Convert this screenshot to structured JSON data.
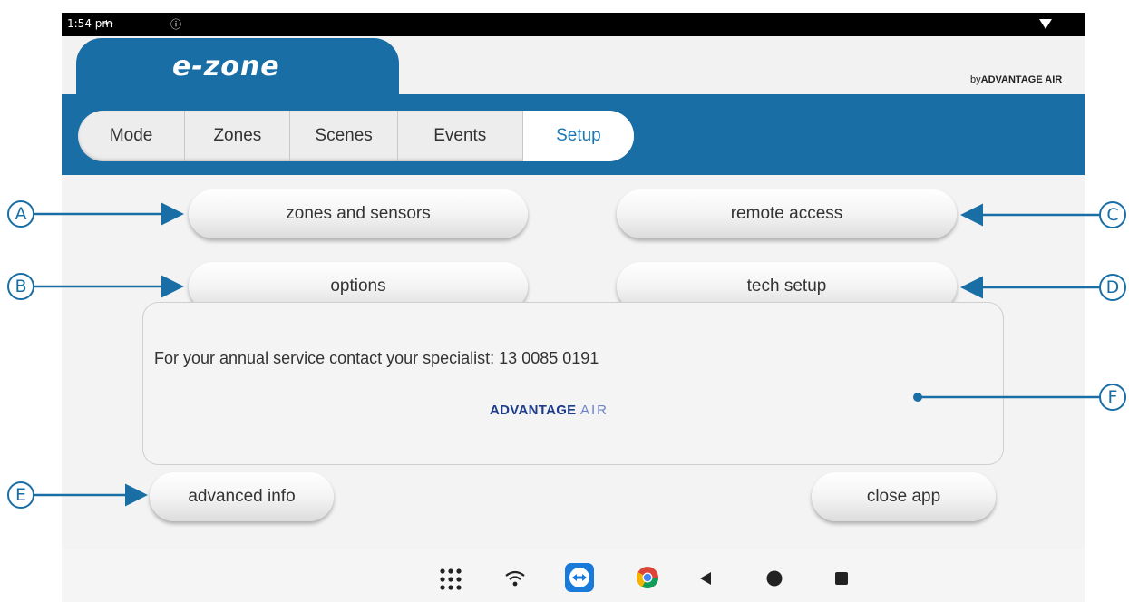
{
  "status_bar": {
    "time": "1:54 pm",
    "extra": "-+-",
    "info": "ⓘ"
  },
  "header": {
    "logo": "e-zone",
    "brand_prefix": "by",
    "brand_name": "ADVANTAGE AIR"
  },
  "tabs": [
    {
      "label": "Mode",
      "active": false
    },
    {
      "label": "Zones",
      "active": false
    },
    {
      "label": "Scenes",
      "active": false
    },
    {
      "label": "Events",
      "active": false
    },
    {
      "label": "Setup",
      "active": true
    }
  ],
  "buttons": {
    "zones_and_sensors": "zones and sensors",
    "remote_access": "remote access",
    "options": "options",
    "tech_setup": "tech setup",
    "advanced_info": "advanced info",
    "close_app": "close app"
  },
  "info_box": {
    "text": "For your annual service contact your specialist: 13 0085 0191",
    "brand_bold": "ADVANTAGE",
    "brand_light": "AIR"
  },
  "callouts": {
    "a": "A",
    "b": "B",
    "c": "C",
    "d": "D",
    "e": "E",
    "f": "F"
  },
  "colors": {
    "brand_blue": "#1a6ea6",
    "active_tab_text": "#1a78b8"
  },
  "nav_icons": [
    "apps-icon",
    "wifi-icon",
    "teamviewer-icon",
    "chrome-icon",
    "back-icon",
    "home-icon",
    "recents-icon"
  ]
}
